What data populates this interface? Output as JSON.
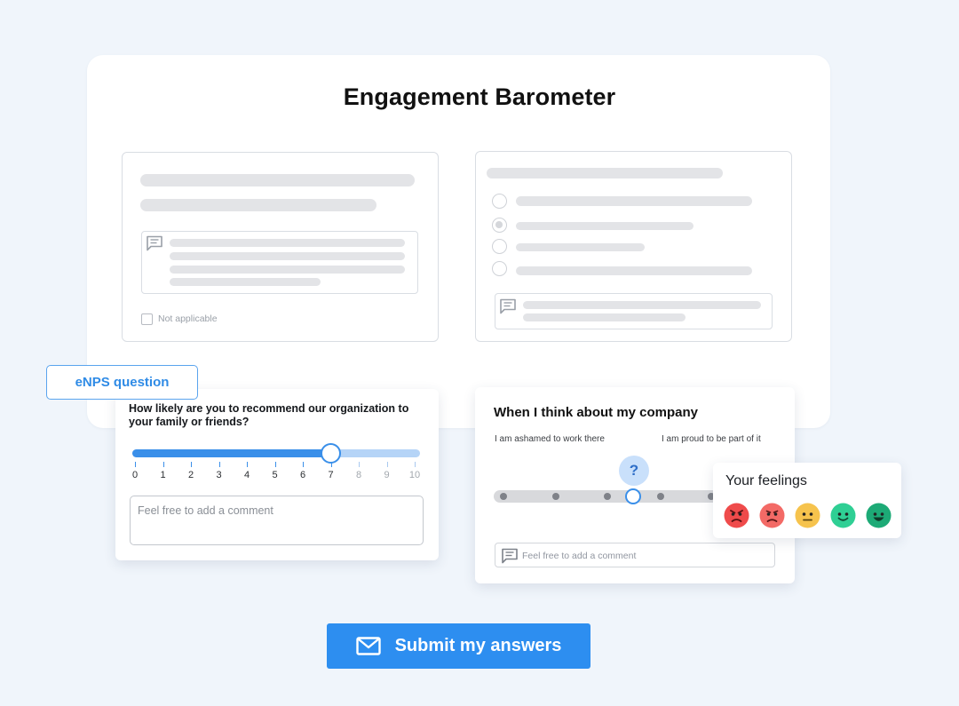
{
  "page": {
    "title": "Engagement Barometer"
  },
  "skeleton_left": {
    "not_applicable_label": "Not applicable"
  },
  "enps": {
    "tag_label": "eNPS question",
    "question": "How likely are you to recommend our organization to your family or friends?",
    "scale": [
      "0",
      "1",
      "2",
      "3",
      "4",
      "5",
      "6",
      "7",
      "8",
      "9",
      "10"
    ],
    "selected_value": 7,
    "comment_placeholder": "Feel free to add a comment",
    "accent_color": "#3a8fe9"
  },
  "company": {
    "title": "When I think about my company",
    "label_left": "I am ashamed to work there",
    "label_right": "I am proud to be part of it",
    "marker": "?",
    "comment_placeholder": "Feel free to add a comment"
  },
  "feelings": {
    "title": "Your feelings",
    "faces": [
      {
        "icon": "angry-face-icon",
        "color": "#ef4b4b"
      },
      {
        "icon": "annoyed-face-icon",
        "color": "#f36a66"
      },
      {
        "icon": "neutral-face-icon",
        "color": "#f6c34d"
      },
      {
        "icon": "smiling-face-icon",
        "color": "#2fcf94"
      },
      {
        "icon": "grinning-face-icon",
        "color": "#1daa76"
      }
    ]
  },
  "submit": {
    "label": "Submit my answers",
    "color": "#2d8ef0"
  }
}
